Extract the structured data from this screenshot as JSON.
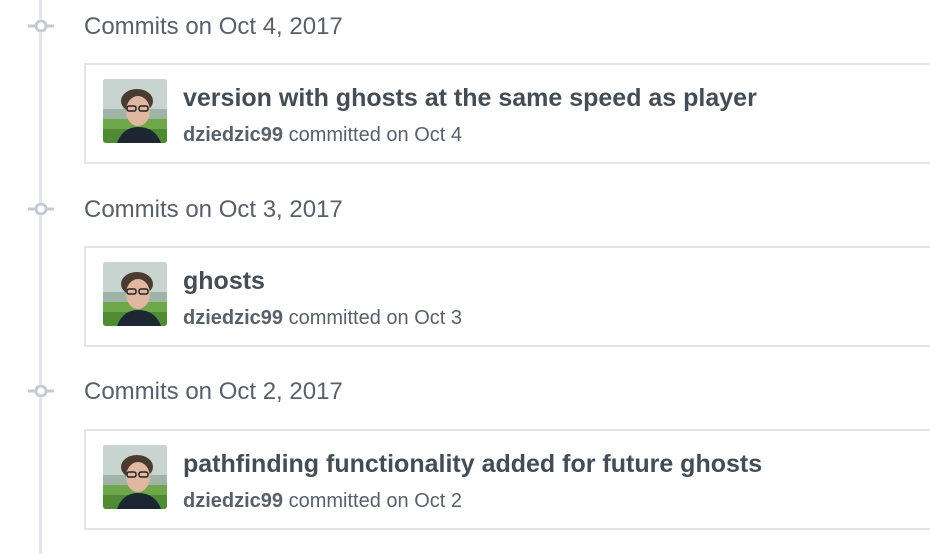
{
  "commit_groups": [
    {
      "heading": "Commits on Oct 4, 2017",
      "commit": {
        "message": "version with ghosts at the same speed as player",
        "author": "dziedzic99",
        "action": "committed on",
        "date": "Oct 4"
      }
    },
    {
      "heading": "Commits on Oct 3, 2017",
      "commit": {
        "message": "ghosts",
        "author": "dziedzic99",
        "action": "committed on",
        "date": "Oct 3"
      }
    },
    {
      "heading": "Commits on Oct 2, 2017",
      "commit": {
        "message": "pathfinding functionality added for future ghosts",
        "author": "dziedzic99",
        "action": "committed on",
        "date": "Oct 2"
      }
    }
  ],
  "colors": {
    "timeline": "#e1e4e8",
    "heading_text": "#586069",
    "title_text": "#444d56",
    "border": "#e1e4e8"
  },
  "icons": {
    "timeline_node": "git-commit-icon",
    "avatar": "user-avatar"
  }
}
